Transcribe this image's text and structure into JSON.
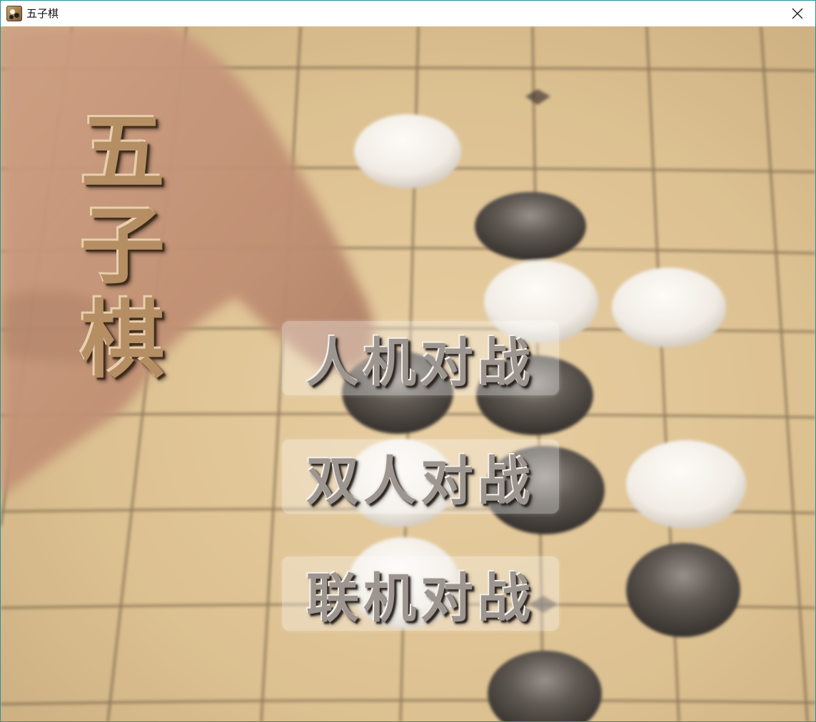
{
  "window": {
    "title": "五子棋",
    "icon": "gomoku-app-icon",
    "close_icon": "close-icon"
  },
  "side_title": [
    "五",
    "子",
    "棋"
  ],
  "menu": {
    "buttons": [
      {
        "label": "人机对战"
      },
      {
        "label": "双人对战"
      },
      {
        "label": "联机对战"
      }
    ]
  },
  "colors": {
    "board": "#e3c99a",
    "grid_line": "#3a2c1c",
    "border_accent": "#2a8fa0"
  }
}
